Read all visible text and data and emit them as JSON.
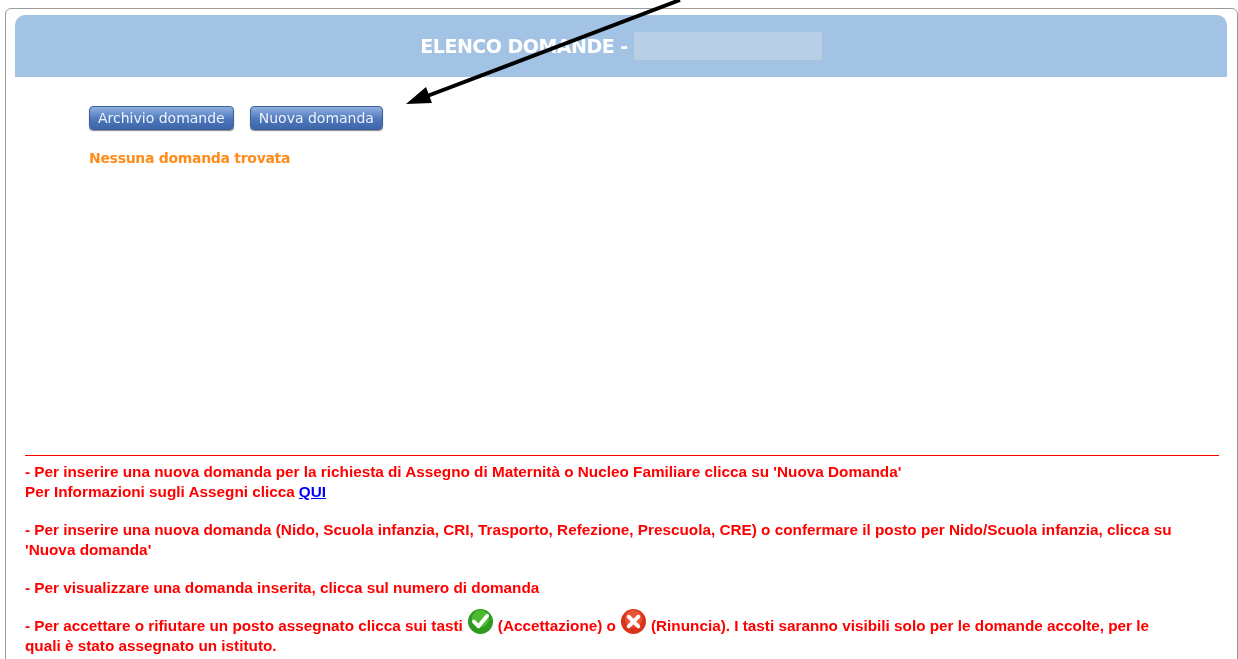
{
  "header": {
    "title": "ELENCO DOMANDE -"
  },
  "buttons": [
    {
      "label": "Archivio domande"
    },
    {
      "label": "Nuova domanda"
    }
  ],
  "status_message": "Nessuna domanda trovata",
  "notes": [
    {
      "lines": [
        [
          {
            "kind": "text",
            "text": "- Per inserire una nuova domanda per la richiesta di Assegno di Maternità o Nucleo Familiare clicca su 'Nuova Domanda'"
          }
        ],
        [
          {
            "kind": "text",
            "text": "Per Informazioni sugli Assegni clicca"
          },
          {
            "kind": "link",
            "text": "QUI"
          }
        ]
      ]
    },
    {
      "lines": [
        [
          {
            "kind": "text",
            "text": "- Per inserire una nuova domanda (Nido, Scuola infanzia, CRI, Trasporto, Refezione, Prescuola, CRE) o confermare il posto per Nido/Scuola infanzia, clicca su"
          }
        ],
        [
          {
            "kind": "text",
            "text": "'Nuova domanda'"
          }
        ]
      ]
    },
    {
      "lines": [
        [
          {
            "kind": "text",
            "text": "- Per visualizzare una domanda inserita, clicca sul numero di domanda"
          }
        ]
      ]
    },
    {
      "lines": [
        [
          {
            "kind": "text",
            "text": "- Per accettare o rifiutare un posto assegnato clicca sui tasti"
          },
          {
            "kind": "accept"
          },
          {
            "kind": "text",
            "text": "(Accettazione) o"
          },
          {
            "kind": "reject"
          },
          {
            "kind": "text",
            "text": "(Rinuncia). I tasti saranno visibili solo per le domande accolte, per le"
          }
        ],
        [
          {
            "kind": "text",
            "text": "quali è stato assegnato un istituto."
          }
        ]
      ]
    }
  ]
}
